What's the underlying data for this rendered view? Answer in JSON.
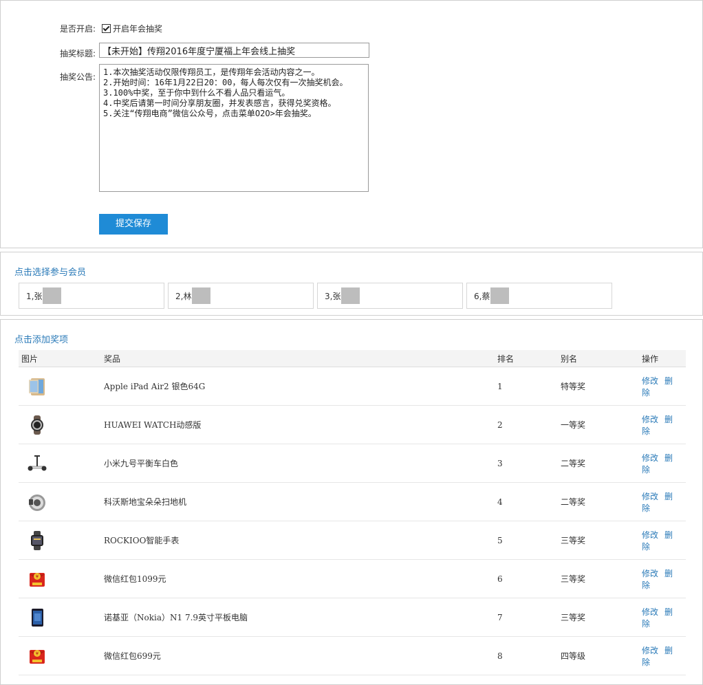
{
  "settings": {
    "enable_label": "是否开启:",
    "enable_checkbox_label": "开启年会抽奖",
    "title_label": "抽奖标题:",
    "title_value": "【未开始】传翔2016年度宁厦福上年会线上抽奖",
    "notice_label": "抽奖公告:",
    "notice_value": "1.本次抽奖活动仅限传翔员工，是传翔年会活动内容之一。\n2.开始时间：16年1月22日20：00，每人每次仅有一次抽奖机会。\n3.100%中奖，至于你中到什么不看人品只看运气。\n4.中奖后请第一时间分享朋友圈，并发表感言，获得兑奖资格。\n5.关注“传翔电商”微信公众号，点击菜单O2O>年会抽奖。",
    "submit_label": "提交保存"
  },
  "members": {
    "title": "点击选择参与会员",
    "items": [
      {
        "label": "1,张"
      },
      {
        "label": "2,林"
      },
      {
        "label": "3,张"
      },
      {
        "label": "6,蔡"
      }
    ]
  },
  "prizes": {
    "title": "点击添加奖项",
    "headers": {
      "image": "图片",
      "name": "奖品",
      "rank": "排名",
      "alias": "别名",
      "actions": "操作"
    },
    "edit_label": "修改",
    "delete_label": "删除",
    "rows": [
      {
        "name": "Apple iPad Air2 银色64G",
        "rank": "1",
        "alias": "特等奖",
        "icon": "tablet-icon"
      },
      {
        "name": "HUAWEI WATCH动感版",
        "rank": "2",
        "alias": "一等奖",
        "icon": "watch-icon"
      },
      {
        "name": "小米九号平衡车白色",
        "rank": "3",
        "alias": "二等奖",
        "icon": "scooter-icon"
      },
      {
        "name": "科沃斯地宝朵朵扫地机",
        "rank": "4",
        "alias": "二等奖",
        "icon": "robot-vacuum-icon"
      },
      {
        "name": "ROCKIOO智能手表",
        "rank": "5",
        "alias": "三等奖",
        "icon": "smartwatch-icon"
      },
      {
        "name": "微信红包1099元",
        "rank": "6",
        "alias": "三等奖",
        "icon": "red-envelope-icon"
      },
      {
        "name": "诺基亚（Nokia）N1 7.9英寸平板电脑",
        "rank": "7",
        "alias": "三等奖",
        "icon": "tablet-dark-icon"
      },
      {
        "name": "微信红包699元",
        "rank": "8",
        "alias": "四等级",
        "icon": "red-envelope-icon"
      }
    ]
  },
  "colors": {
    "accent": "#1f8bd6",
    "link": "#2a7ab8"
  }
}
